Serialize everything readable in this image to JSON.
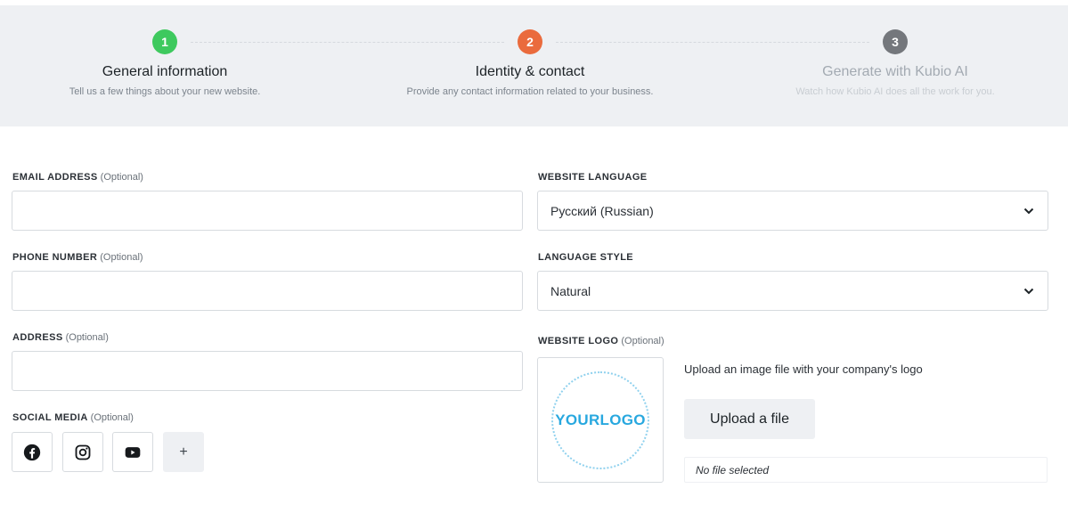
{
  "stepper": {
    "steps": [
      {
        "number": "1",
        "title": "General information",
        "description": "Tell us a few things about your new website.",
        "state": "done",
        "color": "#3ec95e"
      },
      {
        "number": "2",
        "title": "Identity & contact",
        "description": "Provide any contact information related to your business.",
        "state": "active",
        "color": "#ea6b3d"
      },
      {
        "number": "3",
        "title": "Generate with Kubio AI",
        "description": "Watch how Kubio AI does all the work for you.",
        "state": "inactive",
        "color": "#74777c"
      }
    ]
  },
  "form": {
    "optional_text": "(Optional)",
    "email": {
      "label": "EMAIL ADDRESS",
      "value": "",
      "placeholder": ""
    },
    "phone": {
      "label": "PHONE NUMBER",
      "value": "",
      "placeholder": ""
    },
    "address": {
      "label": "ADDRESS",
      "value": "",
      "placeholder": ""
    },
    "social": {
      "label": "SOCIAL MEDIA",
      "icons": [
        "facebook-icon",
        "instagram-icon",
        "youtube-icon"
      ],
      "add_label": "+"
    },
    "website_language": {
      "label": "WEBSITE LANGUAGE",
      "selected": "Русский (Russian)"
    },
    "language_style": {
      "label": "LANGUAGE STYLE",
      "selected": "Natural"
    },
    "website_logo": {
      "label": "WEBSITE LOGO",
      "placeholder_logo_text": "YOURLOGO",
      "hint": "Upload an image file with your company's logo",
      "upload_button": "Upload a file",
      "file_status": "No file selected"
    }
  }
}
